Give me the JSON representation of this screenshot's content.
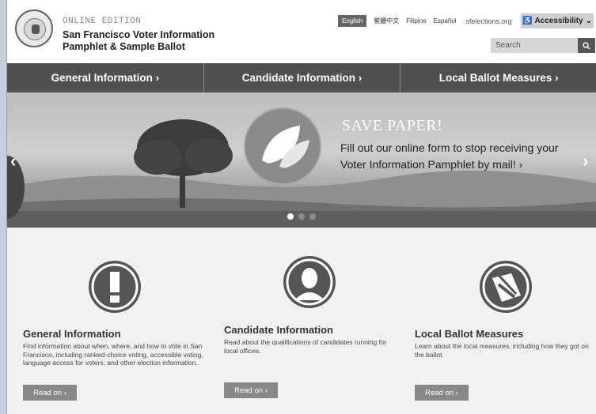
{
  "header": {
    "edition": "ONLINE EDITION",
    "title_line1": "San Francisco Voter Information",
    "title_line2": "Pamphlet & Sample Ballot",
    "languages": [
      "English",
      "繁體中文",
      "Filipino",
      "Español"
    ],
    "site_link": "sfelections.org",
    "accessibility_label": "Accessibility",
    "search_placeholder": "Search"
  },
  "nav": {
    "items": [
      "General Information",
      "Candidate Information",
      "Local Ballot Measures"
    ]
  },
  "hero": {
    "title": "SAVE PAPER!",
    "text": "Fill out our online form to stop receiving your Voter Information Pamphlet by mail!",
    "active_slide": 1,
    "slide_count": 3
  },
  "sections": [
    {
      "title": "General Information",
      "description": "Find information about when, where, and how to vote in San Francisco, including ranked-choice voting, accessible voting, language access for voters, and other election information.",
      "button": "Read on"
    },
    {
      "title": "Candidate Information",
      "description": "Read about the qualifications of candidates running for local offices.",
      "button": "Read on"
    },
    {
      "title": "Local Ballot Measures",
      "description": "Learn about the local measures, including how they got on the ballot.",
      "button": "Read on"
    }
  ],
  "colors": {
    "nav_bg": "#505050",
    "button_bg": "#888888",
    "content_bg": "#f2f2f2"
  }
}
